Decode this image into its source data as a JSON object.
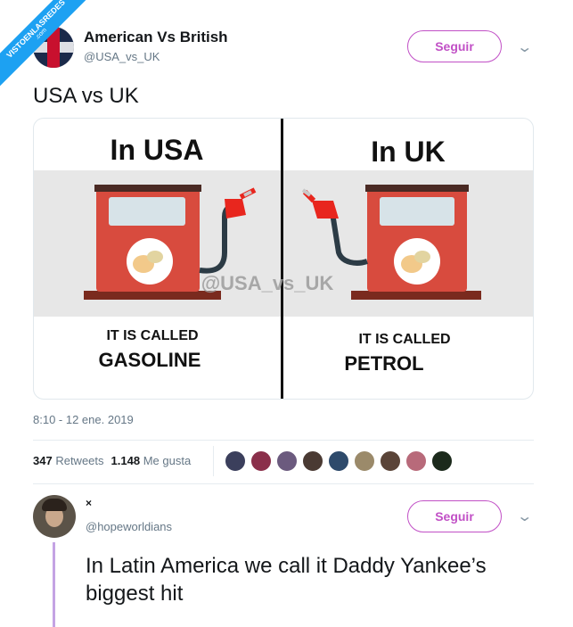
{
  "watermark": {
    "line1": "VISTOENLASREDES",
    "line2": ".com"
  },
  "tweet": {
    "author_name": "American Vs British",
    "author_handle": "@USA_vs_UK",
    "follow_label": "Seguir",
    "text": "USA vs UK",
    "timestamp": "8:10 - 12 ene. 2019",
    "retweets_count": "347",
    "retweets_label": "Retweets",
    "likes_count": "1.148",
    "likes_label": "Me gusta"
  },
  "media": {
    "left_title": "In USA",
    "right_title": "In UK",
    "left_caption_line1": "IT IS CALLED",
    "left_caption_line2": "GASOLINE",
    "right_caption_line1": "IT IS CALLED",
    "right_caption_line2": "PETROL",
    "watermark": "@USA_vs_UK"
  },
  "likers": [
    "#3b3f5c",
    "#8a2f4a",
    "#6b5a7e",
    "#4a3a33",
    "#2e4a6b",
    "#9b8a6a",
    "#5a4438",
    "#b86a7a",
    "#1c2a1c"
  ],
  "reply": {
    "author_name": "×",
    "author_handle": "@hopeworldians",
    "follow_label": "Seguir",
    "text": "In Latin America we call it Daddy Yankee’s biggest hit"
  },
  "colors": {
    "accent": "#c150c6",
    "link": "#1da1f2",
    "pump": "#d84b3e",
    "nozzle": "#e8261e"
  }
}
